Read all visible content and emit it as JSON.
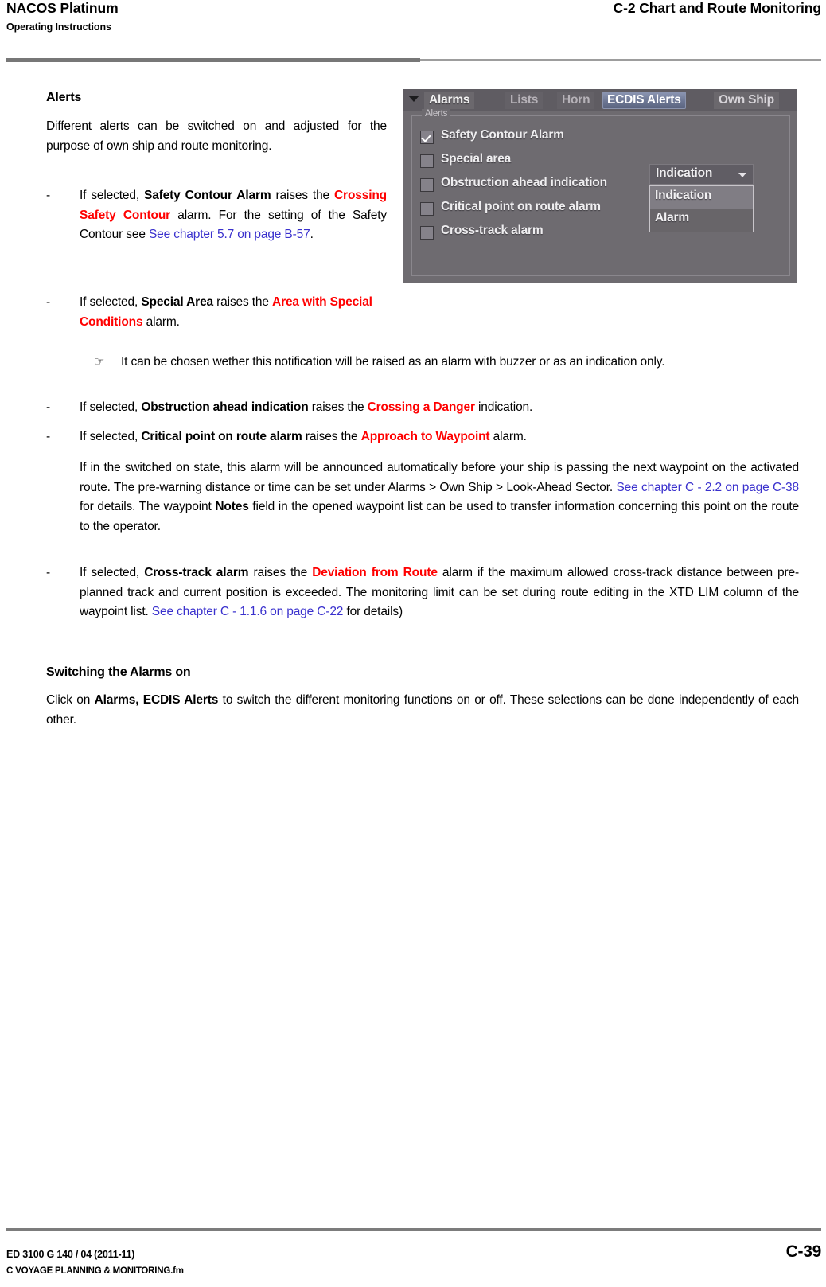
{
  "header": {
    "product": "NACOS Platinum",
    "subtitle": "Operating Instructions",
    "chapter": "C-2  Chart and Route Monitoring"
  },
  "content": {
    "alerts_heading": "Alerts",
    "intro": "Different alerts can be switched on and adjusted for the purpose of own ship and route monitoring.",
    "bullet_marker": "-",
    "note_marker": "☞",
    "bullet1": {
      "t1": "If selected, ",
      "b1": "Safety Contour Alarm",
      "t2": " raises the ",
      "r1": "Crossing Safety Contour",
      "t3": " alarm. For the setting of the Safety Contour see ",
      "x1": "See chapter 5.7 on page B-57",
      "t4": "."
    },
    "bullet2": {
      "t1": "If selected, ",
      "b1": "Special Area",
      "t2": " raises the ",
      "r1": "Area with Special Conditions",
      "t3": " alarm."
    },
    "note1": "It can be chosen wether this notification will be raised as an alarm with buzzer or as an indication only.",
    "bullet3": {
      "t1": "If selected, ",
      "b1": "Obstruction ahead indication",
      "t2": " raises the ",
      "r1": "Crossing a Danger",
      "t3": " indication."
    },
    "bullet4": {
      "t1": "If selected, ",
      "b1": "Critical point on route alarm",
      "t2": " raises the ",
      "r1": "Approach to Waypoint",
      "t3": " alarm."
    },
    "para_waypoint": {
      "t1": "If in the switched on state, this alarm will be announced automatically before your ship is passing the next waypoint on the activated route. The pre-warning distance or time can be set under Alarms > Own Ship > Look-Ahead Sector. ",
      "x1": "See chapter C - 2.2 on page C-38",
      "t2": " for details. The waypoint ",
      "b1": "Notes",
      "t3": " field in the opened waypoint list can be used to transfer information concerning this point on the route to the operator."
    },
    "bullet5": {
      "t1": "If selected, ",
      "b1": "Cross-track alarm",
      "t2": " raises the ",
      "r1": "Deviation from Route",
      "t3": " alarm if the maximum allowed cross-track distance between pre-planned track and current position is exceeded. The monitoring limit can be set during route editing in the XTD LIM column of the waypoint list. ",
      "x1": "See chapter C - 1.1.6 on page C-22",
      "t4": " for details)"
    },
    "switching_heading": "Switching the Alarms on",
    "switching_para": {
      "t1": "Click on ",
      "b1": "Alarms, ECDIS Alerts",
      "t2": " to switch the different monitoring functions on or off. These selections can be done independently of each other."
    }
  },
  "screenshot": {
    "tabs": [
      {
        "label": "Alarms",
        "state": "normal"
      },
      {
        "label": "Lists",
        "state": "dim"
      },
      {
        "label": "Horn",
        "state": "dim"
      },
      {
        "label": "ECDIS Alerts",
        "state": "selected"
      },
      {
        "label": "Own Ship",
        "state": "normal"
      }
    ],
    "group_legend": "Alerts",
    "checkboxes": [
      {
        "label": "Safety Contour Alarm",
        "checked": true
      },
      {
        "label": "Special area",
        "checked": false
      },
      {
        "label": "Obstruction ahead indication",
        "checked": false
      },
      {
        "label": "Critical point on route alarm",
        "checked": false
      },
      {
        "label": "Cross-track alarm",
        "checked": false
      }
    ],
    "dropdown": {
      "value": "Indication",
      "options": [
        {
          "label": "Indication",
          "selected": true
        },
        {
          "label": "Alarm",
          "selected": false
        }
      ]
    }
  },
  "footer": {
    "doc_id": "ED 3100 G 140 / 04 (2011-11)",
    "file_name": "C VOYAGE PLANNING & MONITORING.fm",
    "page": "C-39"
  },
  "colors": {
    "alarm_red": "#ff0000",
    "xref_blue": "#3a31cd",
    "rule_gray": "#777777",
    "panel_bg": "#6e6b70",
    "tab_selected": "#6d7794"
  }
}
